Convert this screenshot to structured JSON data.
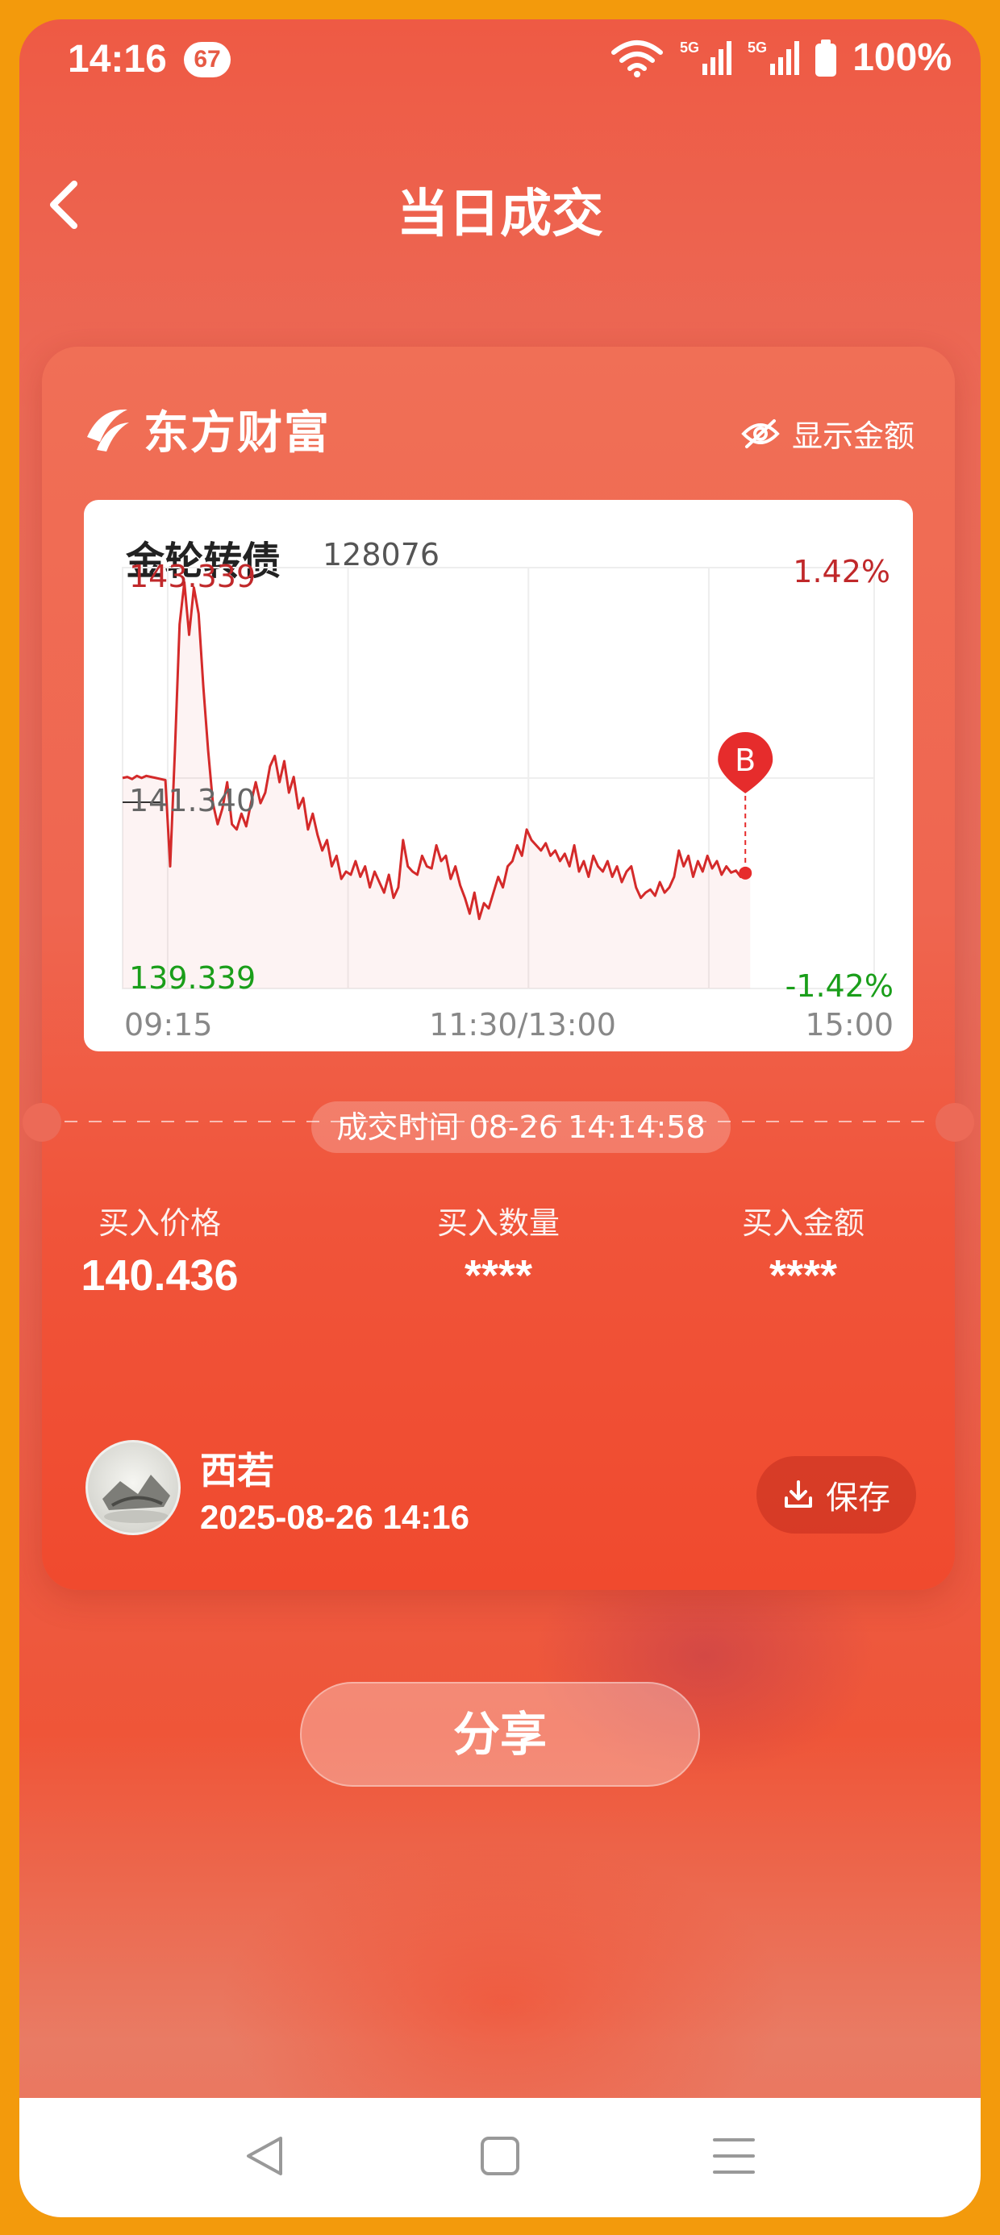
{
  "status_bar": {
    "time": "14:16",
    "badge": "67",
    "battery": "100%",
    "signal1": "5G",
    "signal2": "5G"
  },
  "page": {
    "title": "当日成交"
  },
  "card": {
    "logo_text": "东方财富",
    "show_amount_label": "显示金额",
    "stock": {
      "name": "金轮转债",
      "code": "128076"
    },
    "deal_time": "成交时间 08-26 14:14:58",
    "stats": [
      {
        "label": "买入价格",
        "value": "140.436"
      },
      {
        "label": "买入数量",
        "value": "****"
      },
      {
        "label": "买入金额",
        "value": "****"
      }
    ],
    "user": {
      "name": "西若",
      "datetime": "2025-08-26 14:16"
    },
    "save_label": "保存"
  },
  "share_label": "分享",
  "colors": {
    "accent": "#ee5a44",
    "price_line": "#d42a2a",
    "up": "#c0282a",
    "down": "#1a9e1a"
  },
  "chart_data": {
    "type": "line",
    "y_high": "143.339",
    "y_mid": "141.340",
    "y_low": "139.339",
    "pct_high": "1.42%",
    "pct_low": "-1.42%",
    "x_labels": [
      "09:15",
      "11:30/13:00",
      "15:00"
    ],
    "ylim": [
      139.339,
      143.339
    ],
    "trade_marker": {
      "label": "B",
      "price": 140.436
    },
    "series": [
      {
        "values": [
          141.34,
          141.35,
          141.33,
          141.36,
          141.34,
          141.36,
          141.35,
          141.34,
          141.33,
          141.32,
          140.5,
          141.6,
          142.8,
          143.2,
          142.7,
          143.15,
          142.9,
          142.2,
          141.6,
          141.1,
          140.9,
          141.05,
          141.3,
          140.9,
          140.85,
          141.0,
          140.88,
          141.1,
          141.3,
          141.1,
          141.2,
          141.45,
          141.55,
          141.3,
          141.5,
          141.2,
          141.35,
          141.05,
          141.15,
          140.85,
          141.0,
          140.8,
          140.65,
          140.75,
          140.5,
          140.6,
          140.38,
          140.45,
          140.42,
          140.55,
          140.4,
          140.5,
          140.3,
          140.45,
          140.35,
          140.25,
          140.42,
          140.2,
          140.3,
          140.75,
          140.5,
          140.45,
          140.42,
          140.6,
          140.5,
          140.48,
          140.7,
          140.55,
          140.6,
          140.38,
          140.5,
          140.32,
          140.2,
          140.05,
          140.25,
          140.0,
          140.15,
          140.1,
          140.25,
          140.4,
          140.3,
          140.5,
          140.55,
          140.7,
          140.6,
          140.85,
          140.75,
          140.7,
          140.65,
          140.72,
          140.6,
          140.65,
          140.55,
          140.62,
          140.5,
          140.7,
          140.45,
          140.55,
          140.4,
          140.6,
          140.5,
          140.45,
          140.55,
          140.4,
          140.5,
          140.35,
          140.45,
          140.5,
          140.3,
          140.2,
          140.25,
          140.28,
          140.22,
          140.35,
          140.25,
          140.3,
          140.4,
          140.65,
          140.5,
          140.6,
          140.4,
          140.55,
          140.45,
          140.6,
          140.48,
          140.55,
          140.42,
          140.5,
          140.44,
          140.46,
          140.4,
          140.44,
          140.436
        ]
      }
    ]
  }
}
